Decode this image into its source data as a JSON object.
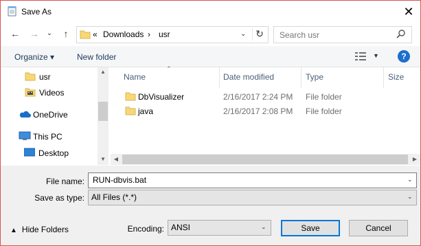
{
  "window": {
    "title": "Save As",
    "close_glyph": "✕"
  },
  "nav_buttons": {
    "back": "←",
    "forward": "→",
    "dropdown": "⌄",
    "up": "↑"
  },
  "address": {
    "overflow": "«",
    "crumbs": [
      "Downloads",
      "usr"
    ],
    "separator": "›",
    "refresh": "↻",
    "dropdown": "⌄"
  },
  "search": {
    "placeholder": "Search usr"
  },
  "toolbar": {
    "organize": "Organize ▾",
    "new_folder": "New folder",
    "help": "?"
  },
  "sidebar": {
    "items": [
      {
        "label": "usr",
        "icon": "folder-icon"
      },
      {
        "label": "Videos",
        "icon": "videos-icon"
      },
      {
        "label": "OneDrive",
        "icon": "onedrive-icon"
      },
      {
        "label": "This PC",
        "icon": "computer-icon"
      },
      {
        "label": "Desktop",
        "icon": "desktop-icon"
      }
    ]
  },
  "columns": [
    "Name",
    "Date modified",
    "Type",
    "Size"
  ],
  "files": [
    {
      "name": "DbVisualizer",
      "date": "2/16/2017 2:24 PM",
      "type": "File folder"
    },
    {
      "name": "java",
      "date": "2/16/2017 2:08 PM",
      "type": "File folder"
    }
  ],
  "form": {
    "file_name_label": "File name:",
    "file_name_value": "RUN-dbvis.bat",
    "save_type_label": "Save as type:",
    "save_type_value": "All Files  (*.*)",
    "encoding_label": "Encoding:",
    "encoding_value": "ANSI"
  },
  "buttons": {
    "hide_folders": "Hide Folders",
    "save": "Save",
    "cancel": "Cancel"
  },
  "colors": {
    "accent": "#0078d7",
    "folder": "#f8d775",
    "help": "#1b6fce",
    "window_border": "#d9534f"
  }
}
